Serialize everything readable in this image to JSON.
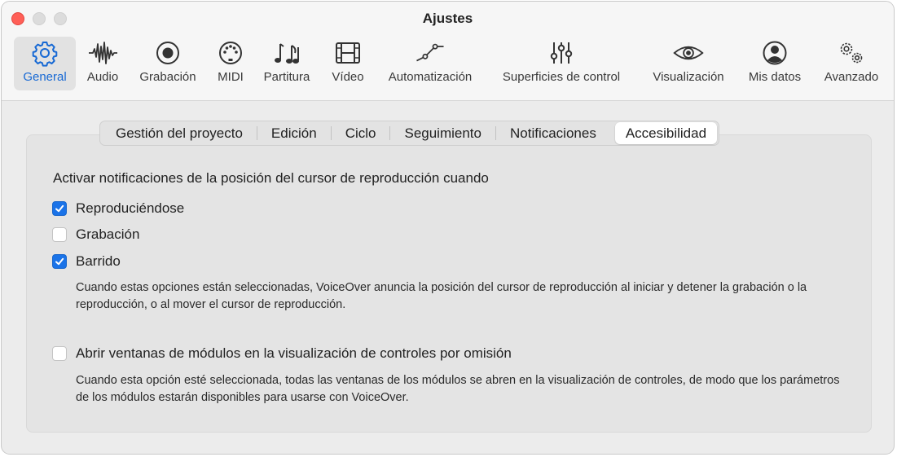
{
  "window": {
    "title": "Ajustes"
  },
  "toolbar": {
    "items": [
      {
        "label": "General",
        "icon": "gear-icon",
        "active": true
      },
      {
        "label": "Audio",
        "icon": "waveform-icon"
      },
      {
        "label": "Grabación",
        "icon": "record-icon"
      },
      {
        "label": "MIDI",
        "icon": "midi-connector-icon"
      },
      {
        "label": "Partitura",
        "icon": "music-notes-icon"
      },
      {
        "label": "Vídeo",
        "icon": "film-icon"
      },
      {
        "label": "Automatización",
        "icon": "automation-curve-icon"
      },
      {
        "label": "Superficies de control",
        "icon": "faders-icon"
      },
      {
        "label": "Visualización",
        "icon": "eye-icon"
      },
      {
        "label": "Mis datos",
        "icon": "person-icon"
      },
      {
        "label": "Avanzado",
        "icon": "gears-icon"
      }
    ],
    "accent_color": "#1769d4"
  },
  "tabs": [
    {
      "label": "Gestión del proyecto"
    },
    {
      "label": "Edición"
    },
    {
      "label": "Ciclo"
    },
    {
      "label": "Seguimiento"
    },
    {
      "label": "Notificaciones"
    },
    {
      "label": "Accesibilidad",
      "selected": true
    }
  ],
  "content": {
    "heading": "Activar notificaciones de la posición del cursor de reproducción cuando",
    "checkboxes": [
      {
        "label": "Reproduciéndose",
        "checked": true
      },
      {
        "label": "Grabación",
        "checked": false
      },
      {
        "label": "Barrido",
        "checked": true
      }
    ],
    "description1": "Cuando estas opciones están seleccionadas, VoiceOver anuncia la posición del cursor de reproducción al iniciar y detener la grabación o la reproducción, o al mover el cursor de reproducción.",
    "plugin_checkbox": {
      "label": "Abrir ventanas de módulos en la visualización de controles por omisión",
      "checked": false
    },
    "description2": "Cuando esta opción esté seleccionada, todas las ventanas de los módulos se abren en la visualización de controles, de modo que los parámetros de los módulos estarán disponibles para usarse con VoiceOver."
  },
  "colors": {
    "checkbox_on": "#1a73e8",
    "close_button": "#ff5f57"
  }
}
